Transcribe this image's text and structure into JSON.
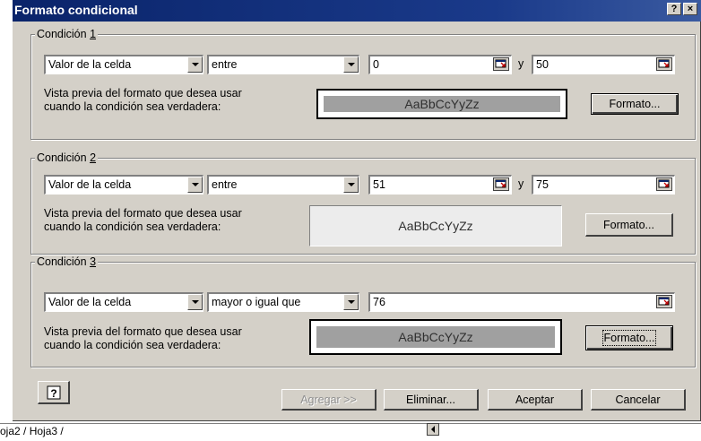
{
  "window": {
    "title": "Formato condicional",
    "help_btn": "?",
    "close_btn": "×"
  },
  "conditions": [
    {
      "legend_prefix": "Condición ",
      "legend_key": "1",
      "operand": "Valor de la celda",
      "operator": "entre",
      "value1": "0",
      "connector": "y",
      "value2": "50",
      "preview_label_line1": "Vista previa del formato que desea usar",
      "preview_label_line2": "cuando la condición sea verdadera:",
      "preview_text": "AaBbCcYyZz",
      "preview_bg": "#a0a0a0",
      "format_button": "Formato..."
    },
    {
      "legend_prefix": "Condición ",
      "legend_key": "2",
      "operand": "Valor de la celda",
      "operator": "entre",
      "value1": "51",
      "connector": "y",
      "value2": "75",
      "preview_label_line1": "Vista previa del formato que desea usar",
      "preview_label_line2": "cuando la condición sea verdadera:",
      "preview_text": "AaBbCcYyZz",
      "preview_bg": "#ececec",
      "format_button": "Formato..."
    },
    {
      "legend_prefix": "Condición ",
      "legend_key": "3",
      "operand": "Valor de la celda",
      "operator": "mayor o igual que",
      "value1": "76",
      "preview_label_line1": "Vista previa del formato que desea usar",
      "preview_label_line2": "cuando la condición sea verdadera:",
      "preview_text": "AaBbCcYyZz",
      "preview_bg": "#a0a0a0",
      "format_button": "Formato..."
    }
  ],
  "footer": {
    "help_icon": "?",
    "add": "Agregar >>",
    "delete": "Eliminar...",
    "ok": "Aceptar",
    "cancel": "Cancelar"
  },
  "sheet_tabs": {
    "label": "oja2 / Hoja3 /"
  },
  "colors": {
    "dialog_bg": "#d4d0c8",
    "title_bg": "#0a246a",
    "preview_gray": "#a0a0a0"
  },
  "icons": {
    "cell_ref": "collapse-dialog-icon",
    "dropdown": "chevron-down-icon",
    "help": "question-icon"
  }
}
